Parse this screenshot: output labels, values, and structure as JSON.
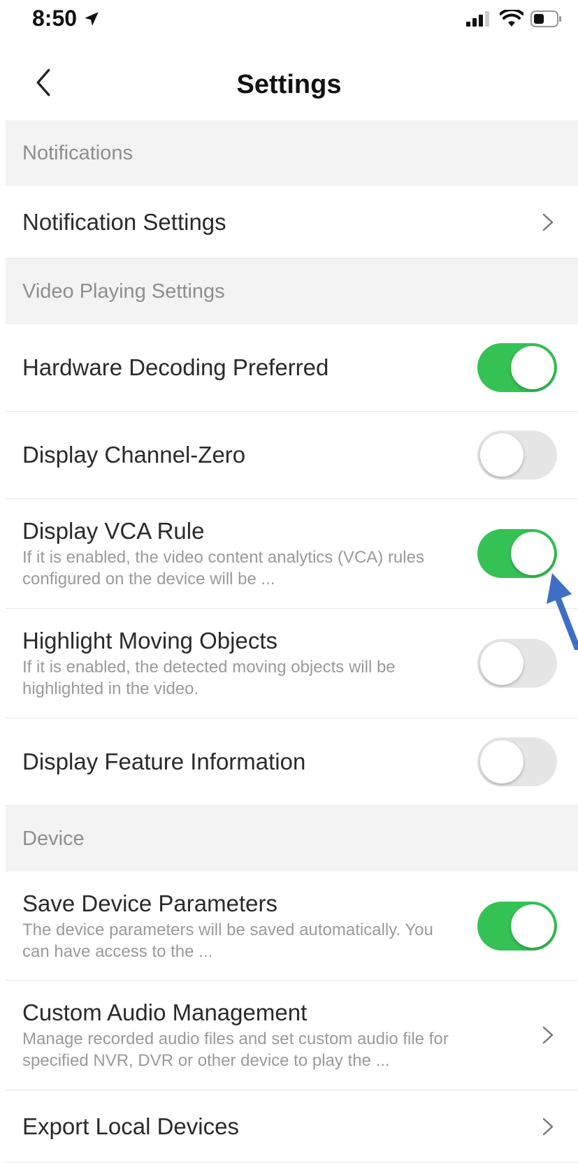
{
  "status_bar": {
    "time": "8:50"
  },
  "nav": {
    "title": "Settings"
  },
  "sections": [
    {
      "header": "Notifications",
      "items": [
        {
          "label": "Notification Settings",
          "desc": "",
          "control": "chevron"
        }
      ]
    },
    {
      "header": "Video Playing Settings",
      "items": [
        {
          "label": "Hardware Decoding Preferred",
          "desc": "",
          "control": "toggle",
          "enabled": true
        },
        {
          "label": "Display Channel-Zero",
          "desc": "",
          "control": "toggle",
          "enabled": false
        },
        {
          "label": "Display VCA Rule",
          "desc": "If it is enabled, the video content analytics (VCA) rules configured on the device will be ...",
          "control": "toggle",
          "enabled": true
        },
        {
          "label": "Highlight Moving Objects",
          "desc": "If it is enabled, the detected moving objects will be highlighted in the video.",
          "control": "toggle",
          "enabled": false
        },
        {
          "label": "Display Feature Information",
          "desc": "",
          "control": "toggle",
          "enabled": false
        }
      ]
    },
    {
      "header": "Device",
      "items": [
        {
          "label": "Save Device Parameters",
          "desc": "The device parameters will be saved automatically. You can have access to the ...",
          "control": "toggle",
          "enabled": true
        },
        {
          "label": "Custom Audio Management",
          "desc": "Manage recorded audio files and set custom audio file for specified NVR, DVR or other device to play the ...",
          "control": "chevron"
        },
        {
          "label": "Export Local Devices",
          "desc": "",
          "control": "chevron"
        }
      ]
    }
  ],
  "colors": {
    "toggle_on": "#34c255",
    "toggle_off": "#e5e5e5",
    "annotation_arrow": "#3f6fc4"
  },
  "icons": {
    "back": "chevron-left-icon",
    "chevron": "chevron-right-icon",
    "location": "location-arrow-icon"
  }
}
